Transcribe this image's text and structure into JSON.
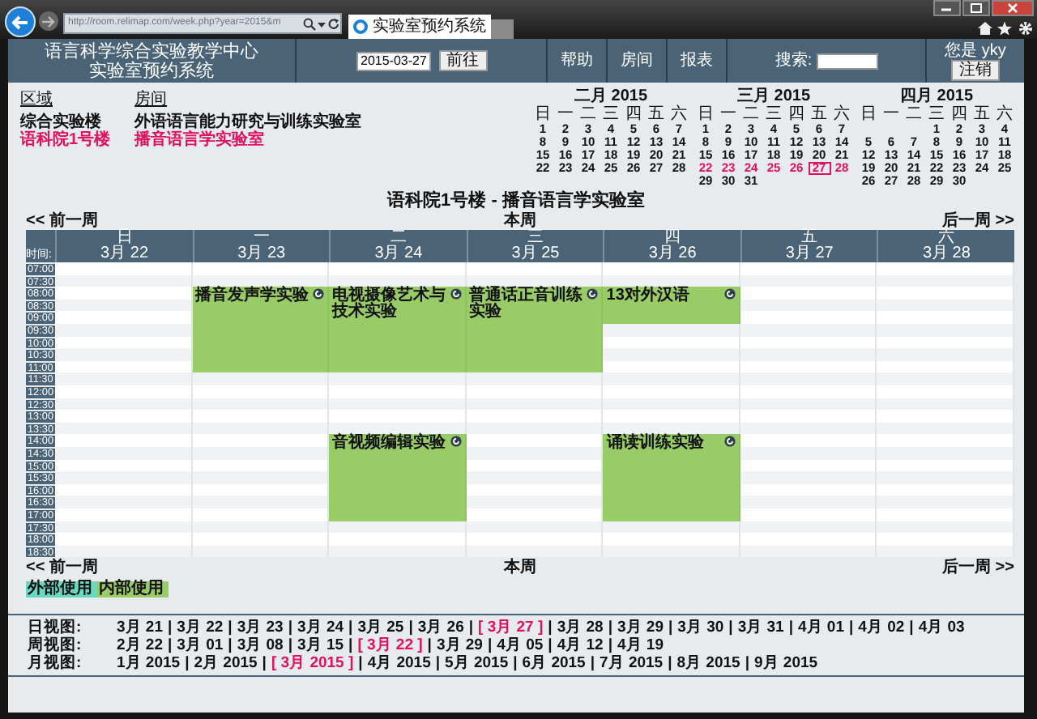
{
  "browser": {
    "address": "http://room.relimap.com/week.php?year=2015&m",
    "tab_title": "实验室预约系统"
  },
  "header": {
    "title_lines": [
      "语言科学综合实验教学中心",
      "实验室预约系统"
    ],
    "date_value": "2015-03-27",
    "go_button": "前往",
    "nav_links": [
      "帮助",
      "房间",
      "报表"
    ],
    "search_label": "搜索:",
    "user_label": "您是 yky",
    "logout_button": "注销"
  },
  "areas": {
    "heading": "区域",
    "items": [
      {
        "label": "综合实验楼",
        "selected": false
      },
      {
        "label": "语科院1号楼",
        "selected": true
      }
    ]
  },
  "rooms": {
    "heading": "房间",
    "items": [
      {
        "label": "外语语言能力研究与训练实验室",
        "selected": false
      },
      {
        "label": "播音语言学实验室",
        "selected": true
      }
    ]
  },
  "mini_calendars": [
    {
      "title": "二月 2015",
      "weekdays": [
        "日",
        "一",
        "二",
        "三",
        "四",
        "五",
        "六"
      ],
      "weeks": [
        {
          "selected": false,
          "days": [
            {
              "label": "1",
              "today": false
            },
            {
              "label": "2",
              "today": false
            },
            {
              "label": "3",
              "today": false
            },
            {
              "label": "4",
              "today": false
            },
            {
              "label": "5",
              "today": false
            },
            {
              "label": "6",
              "today": false
            },
            {
              "label": "7",
              "today": false
            }
          ]
        },
        {
          "selected": false,
          "days": [
            {
              "label": "8",
              "today": false
            },
            {
              "label": "9",
              "today": false
            },
            {
              "label": "10",
              "today": false
            },
            {
              "label": "11",
              "today": false
            },
            {
              "label": "12",
              "today": false
            },
            {
              "label": "13",
              "today": false
            },
            {
              "label": "14",
              "today": false
            }
          ]
        },
        {
          "selected": false,
          "days": [
            {
              "label": "15",
              "today": false
            },
            {
              "label": "16",
              "today": false
            },
            {
              "label": "17",
              "today": false
            },
            {
              "label": "18",
              "today": false
            },
            {
              "label": "19",
              "today": false
            },
            {
              "label": "20",
              "today": false
            },
            {
              "label": "21",
              "today": false
            }
          ]
        },
        {
          "selected": false,
          "days": [
            {
              "label": "22",
              "today": false
            },
            {
              "label": "23",
              "today": false
            },
            {
              "label": "24",
              "today": false
            },
            {
              "label": "25",
              "today": false
            },
            {
              "label": "26",
              "today": false
            },
            {
              "label": "27",
              "today": false
            },
            {
              "label": "28",
              "today": false
            }
          ]
        }
      ]
    },
    {
      "title": "三月 2015",
      "weekdays": [
        "日",
        "一",
        "二",
        "三",
        "四",
        "五",
        "六"
      ],
      "weeks": [
        {
          "selected": false,
          "days": [
            {
              "label": "1",
              "today": false
            },
            {
              "label": "2",
              "today": false
            },
            {
              "label": "3",
              "today": false
            },
            {
              "label": "4",
              "today": false
            },
            {
              "label": "5",
              "today": false
            },
            {
              "label": "6",
              "today": false
            },
            {
              "label": "7",
              "today": false
            }
          ]
        },
        {
          "selected": false,
          "days": [
            {
              "label": "8",
              "today": false
            },
            {
              "label": "9",
              "today": false
            },
            {
              "label": "10",
              "today": false
            },
            {
              "label": "11",
              "today": false
            },
            {
              "label": "12",
              "today": false
            },
            {
              "label": "13",
              "today": false
            },
            {
              "label": "14",
              "today": false
            }
          ]
        },
        {
          "selected": false,
          "days": [
            {
              "label": "15",
              "today": false
            },
            {
              "label": "16",
              "today": false
            },
            {
              "label": "17",
              "today": false
            },
            {
              "label": "18",
              "today": false
            },
            {
              "label": "19",
              "today": false
            },
            {
              "label": "20",
              "today": false
            },
            {
              "label": "21",
              "today": false
            }
          ]
        },
        {
          "selected": true,
          "days": [
            {
              "label": "22",
              "today": false
            },
            {
              "label": "23",
              "today": false
            },
            {
              "label": "24",
              "today": false
            },
            {
              "label": "25",
              "today": false
            },
            {
              "label": "26",
              "today": false
            },
            {
              "label": "27",
              "today": true
            },
            {
              "label": "28",
              "today": false
            }
          ]
        },
        {
          "selected": false,
          "days": [
            {
              "label": "29",
              "today": false
            },
            {
              "label": "30",
              "today": false
            },
            {
              "label": "31",
              "today": false
            }
          ]
        }
      ]
    },
    {
      "title": "四月 2015",
      "weekdays": [
        "日",
        "一",
        "二",
        "三",
        "四",
        "五",
        "六"
      ],
      "weeks": [
        {
          "selected": false,
          "right_aligned": true,
          "days": [
            {
              "label": "1",
              "today": false
            },
            {
              "label": "2",
              "today": false
            },
            {
              "label": "3",
              "today": false
            },
            {
              "label": "4",
              "today": false
            }
          ]
        },
        {
          "selected": false,
          "days": [
            {
              "label": "5",
              "today": false
            },
            {
              "label": "6",
              "today": false
            },
            {
              "label": "7",
              "today": false
            },
            {
              "label": "8",
              "today": false
            },
            {
              "label": "9",
              "today": false
            },
            {
              "label": "10",
              "today": false
            },
            {
              "label": "11",
              "today": false
            }
          ]
        },
        {
          "selected": false,
          "days": [
            {
              "label": "12",
              "today": false
            },
            {
              "label": "13",
              "today": false
            },
            {
              "label": "14",
              "today": false
            },
            {
              "label": "15",
              "today": false
            },
            {
              "label": "16",
              "today": false
            },
            {
              "label": "17",
              "today": false
            },
            {
              "label": "18",
              "today": false
            }
          ]
        },
        {
          "selected": false,
          "days": [
            {
              "label": "19",
              "today": false
            },
            {
              "label": "20",
              "today": false
            },
            {
              "label": "21",
              "today": false
            },
            {
              "label": "22",
              "today": false
            },
            {
              "label": "23",
              "today": false
            },
            {
              "label": "24",
              "today": false
            },
            {
              "label": "25",
              "today": false
            }
          ]
        },
        {
          "selected": false,
          "days": [
            {
              "label": "26",
              "today": false
            },
            {
              "label": "27",
              "today": false
            },
            {
              "label": "28",
              "today": false
            },
            {
              "label": "29",
              "today": false
            },
            {
              "label": "30",
              "today": false
            }
          ]
        }
      ]
    }
  ],
  "page_title": "语科院1号楼 - 播音语言学实验室",
  "week_nav_top": {
    "prev": "<< 前一周",
    "current": "本周",
    "next": "后一周 >>"
  },
  "week_table": {
    "time_heading": "时间:",
    "times": [
      "07:00",
      "07:30",
      "08:00",
      "08:30",
      "09:00",
      "09:30",
      "10:00",
      "10:30",
      "11:00",
      "11:30",
      "12:00",
      "12:30",
      "13:00",
      "13:30",
      "14:00",
      "14:30",
      "15:00",
      "15:30",
      "16:00",
      "16:30",
      "17:00",
      "17:30",
      "18:00",
      "18:30"
    ],
    "days": [
      {
        "weekday": "日",
        "date": "3月 22",
        "slots": [
          false,
          false,
          false,
          false,
          false,
          false,
          false,
          false,
          false,
          false,
          false,
          false,
          false,
          false,
          false,
          false,
          false,
          false,
          false,
          false,
          false,
          false,
          false,
          false
        ]
      },
      {
        "weekday": "一",
        "date": "3月 23",
        "slots": [
          false,
          false,
          true,
          true,
          true,
          true,
          true,
          true,
          true,
          false,
          false,
          false,
          false,
          false,
          false,
          false,
          false,
          false,
          false,
          false,
          false,
          false,
          false,
          false
        ],
        "bookings": [
          {
            "title": "播音发声学实验",
            "color": "#99cc66"
          }
        ]
      },
      {
        "weekday": "二",
        "date": "3月 24",
        "slots": [
          false,
          false,
          true,
          true,
          true,
          true,
          true,
          true,
          true,
          false,
          false,
          false,
          false,
          false,
          true,
          true,
          true,
          true,
          true,
          true,
          true,
          false,
          false,
          false
        ],
        "bookings": [
          {
            "title": "电视摄像艺术与技术实验",
            "color": "#99cc66"
          },
          {
            "title": "音视频编辑实验",
            "color": "#99cc66"
          }
        ]
      },
      {
        "weekday": "三",
        "date": "3月 25",
        "slots": [
          false,
          false,
          true,
          true,
          true,
          true,
          true,
          true,
          true,
          false,
          false,
          false,
          false,
          false,
          false,
          false,
          false,
          false,
          false,
          false,
          false,
          false,
          false,
          false
        ],
        "bookings": [
          {
            "title": "普通话正音训练实验",
            "color": "#99cc66"
          }
        ]
      },
      {
        "weekday": "四",
        "date": "3月 26",
        "slots": [
          false,
          false,
          true,
          true,
          true,
          false,
          false,
          false,
          false,
          false,
          false,
          false,
          false,
          false,
          true,
          true,
          true,
          true,
          true,
          true,
          true,
          false,
          false,
          false
        ],
        "bookings": [
          {
            "title": "13对外汉语",
            "color": "#99cc66"
          },
          {
            "title": "诵读训练实验",
            "color": "#99cc66"
          }
        ]
      },
      {
        "weekday": "五",
        "date": "3月 27",
        "slots": [
          false,
          false,
          false,
          false,
          false,
          false,
          false,
          false,
          false,
          false,
          false,
          false,
          false,
          false,
          false,
          false,
          false,
          false,
          false,
          false,
          false,
          false,
          false,
          false
        ]
      },
      {
        "weekday": "六",
        "date": "3月 28",
        "slots": [
          false,
          false,
          false,
          false,
          false,
          false,
          false,
          false,
          false,
          false,
          false,
          false,
          false,
          false,
          false,
          false,
          false,
          false,
          false,
          false,
          false,
          false,
          false,
          false
        ]
      }
    ]
  },
  "week_nav_bottom": {
    "prev": "<< 前一周",
    "current": "本周",
    "next": "后一周 >>"
  },
  "legend": [
    {
      "label": "外部使用",
      "color": "#66d9c0"
    },
    {
      "label": "内部使用",
      "color": "#99cc66"
    }
  ],
  "views": [
    {
      "label": "日视图:",
      "separator": "|",
      "items": [
        {
          "label": "3月 21",
          "selected": false
        },
        {
          "label": "3月 22",
          "selected": false
        },
        {
          "label": "3月 23",
          "selected": false
        },
        {
          "label": "3月 24",
          "selected": false
        },
        {
          "label": "3月 25",
          "selected": false
        },
        {
          "label": "3月 26",
          "selected": false
        },
        {
          "label": "[ 3月 27 ]",
          "selected": true
        },
        {
          "label": "3月 28",
          "selected": false
        },
        {
          "label": "3月 29",
          "selected": false
        },
        {
          "label": "3月 30",
          "selected": false
        },
        {
          "label": "3月 31",
          "selected": false
        },
        {
          "label": "4月 01",
          "selected": false
        },
        {
          "label": "4月 02",
          "selected": false
        },
        {
          "label": "4月 03",
          "selected": false
        }
      ]
    },
    {
      "label": "周视图:",
      "separator": "|",
      "items": [
        {
          "label": "2月 22",
          "selected": false
        },
        {
          "label": "3月 01",
          "selected": false
        },
        {
          "label": "3月 08",
          "selected": false
        },
        {
          "label": "3月 15",
          "selected": false
        },
        {
          "label": "[ 3月 22 ]",
          "selected": true
        },
        {
          "label": "3月 29",
          "selected": false
        },
        {
          "label": "4月 05",
          "selected": false
        },
        {
          "label": "4月 12",
          "selected": false
        },
        {
          "label": "4月 19",
          "selected": false
        }
      ]
    },
    {
      "label": "月视图:",
      "separator": "|",
      "items": [
        {
          "label": "1月 2015",
          "selected": false
        },
        {
          "label": "2月 2015",
          "selected": false
        },
        {
          "label": "[ 3月 2015 ]",
          "selected": true
        },
        {
          "label": "4月 2015",
          "selected": false
        },
        {
          "label": "5月 2015",
          "selected": false
        },
        {
          "label": "6月 2015",
          "selected": false
        },
        {
          "label": "7月 2015",
          "selected": false
        },
        {
          "label": "8月 2015",
          "selected": false
        },
        {
          "label": "9月 2015",
          "selected": false
        }
      ]
    }
  ]
}
